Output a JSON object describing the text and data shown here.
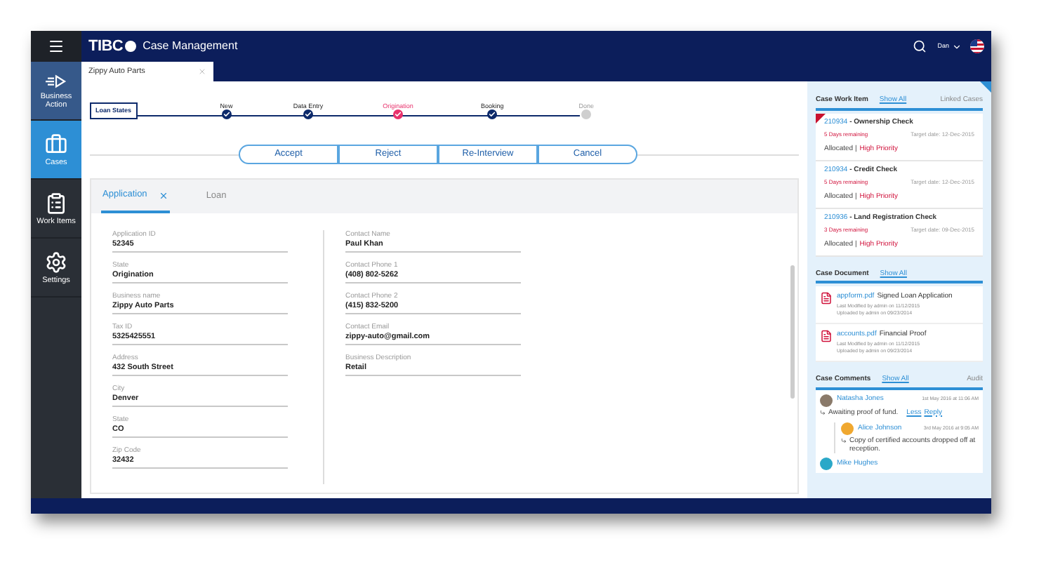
{
  "sidebar": {
    "items": [
      {
        "label": "Business Action",
        "selected": false
      },
      {
        "label": "Cases",
        "selected": true
      },
      {
        "label": "Work Items",
        "selected": false
      },
      {
        "label": "Settings",
        "selected": false
      }
    ]
  },
  "header": {
    "logo": "TIBC",
    "title": "Case Management",
    "user": "Dan"
  },
  "doc_tabs": [
    {
      "label": "Zippy Auto Parts",
      "selected": true
    }
  ],
  "stepper": {
    "label": "Loan States",
    "steps": [
      {
        "label": "New",
        "kind": "done"
      },
      {
        "label": "Data Entry",
        "kind": "done"
      },
      {
        "label": "Origination",
        "kind": "current"
      },
      {
        "label": "Booking",
        "kind": "done"
      },
      {
        "label": "Done",
        "kind": "pending"
      }
    ]
  },
  "actions": [
    "Accept",
    "Reject",
    "Re-Interview",
    "Cancel"
  ],
  "form_tabs": [
    {
      "label": "Application",
      "selected": true,
      "closable": true
    },
    {
      "label": "Loan",
      "selected": false,
      "closable": false
    }
  ],
  "fields_left": [
    {
      "label": "Application ID",
      "value": "52345"
    },
    {
      "label": "State",
      "value": "Origination"
    },
    {
      "label": "Business name",
      "value": "Zippy Auto Parts"
    },
    {
      "label": "Tax ID",
      "value": "5325425551"
    },
    {
      "label": "Address",
      "value": "432 South Street"
    },
    {
      "label": "City",
      "value": "Denver"
    },
    {
      "label": "State",
      "value": "CO"
    },
    {
      "label": "Zip Code",
      "value": "32432"
    }
  ],
  "fields_right": [
    {
      "label": "Contact Name",
      "value": "Paul Khan"
    },
    {
      "label": "Contact Phone 1",
      "value": "(408) 802-5262"
    },
    {
      "label": "Contact Phone 2",
      "value": "(415) 832-5200"
    },
    {
      "label": "Contact Email",
      "value": "zippy-auto@gmail.com"
    },
    {
      "label": "Business Description",
      "value": "Retail"
    }
  ],
  "work_items": {
    "title": "Case Work Item",
    "show_all": "Show All",
    "other_tab": "Linked Cases",
    "items": [
      {
        "id": "210934",
        "name": " - Ownership Check",
        "remaining": "5 Days remaining",
        "target": "Target date: 12-Dec-2015",
        "allocated": "Allocated |",
        "priority": "High Priority",
        "flagged": true
      },
      {
        "id": "210934",
        "name": " - Credit Check",
        "remaining": "5 Days remaining",
        "target": "Target date: 12-Dec-2015",
        "allocated": "Allocated |",
        "priority": "High Priority",
        "flagged": false
      },
      {
        "id": "210936",
        "name": " - Land Registration Check",
        "remaining": "3 Days remaining",
        "target": "Target date: 09-Dec-2015",
        "allocated": "Allocated |",
        "priority": "High Priority",
        "flagged": false
      }
    ]
  },
  "documents": {
    "title": "Case Document",
    "show_all": "Show All",
    "items": [
      {
        "file": "appform.pdf",
        "description": "Signed Loan Application",
        "modified": "Last Modified by admin on 11/12/2015",
        "uploaded": "Uploaded by admin on 09/23/2014"
      },
      {
        "file": "accounts.pdf",
        "description": "Financial Proof",
        "modified": "Last Modified by admin on 11/12/2015",
        "uploaded": "Uploaded by admin on 09/23/2014"
      }
    ]
  },
  "comments": {
    "title": "Case Comments",
    "show_all": "Show All",
    "other_tab": "Audit",
    "items": [
      {
        "author": "Natasha Jones",
        "date": "1st May 2016 at 11:06 AM",
        "text": "Awaiting proof of fund.",
        "links": [
          "Less",
          "Reply"
        ],
        "color": "#8a7a6a",
        "children": [
          {
            "author": "Alice Johnson",
            "date": "3rd May 2016 at 9:05 AM",
            "text": "Copy of certified accounts dropped off at reception.",
            "color": "#f0a830"
          }
        ]
      },
      {
        "author": "Mike Hughes",
        "color": "#2aa8c8"
      }
    ]
  }
}
